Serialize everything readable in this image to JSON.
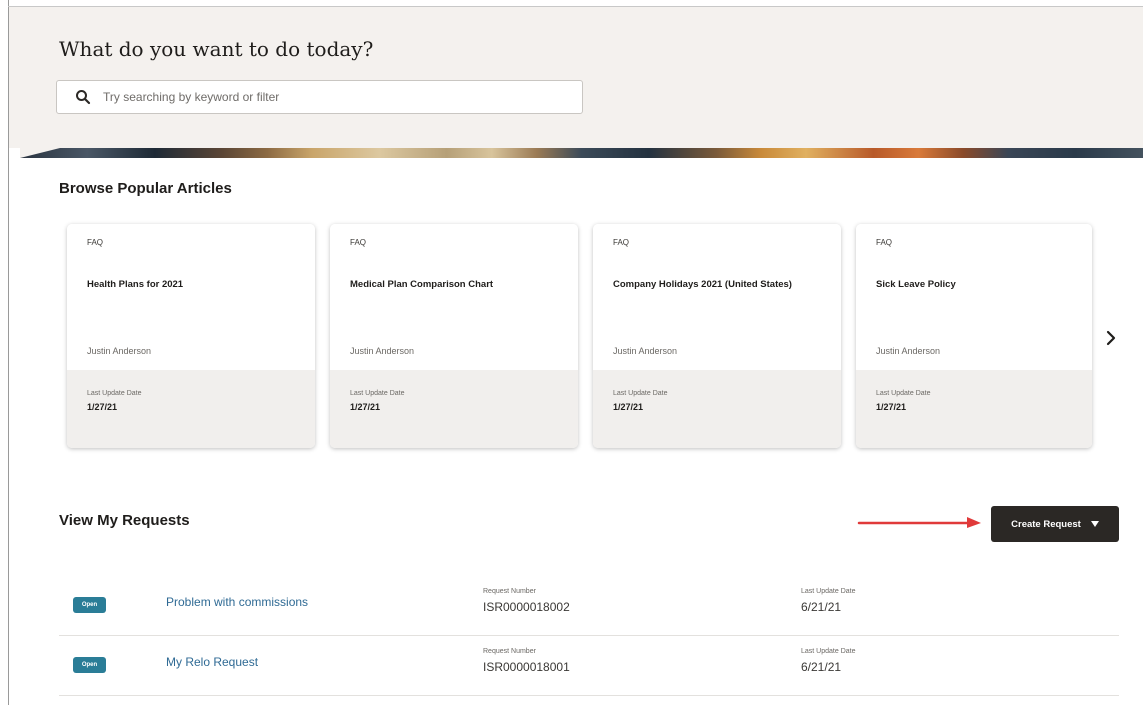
{
  "hero": {
    "title": "What do you want to do today?",
    "search_placeholder": "Try searching by keyword or filter"
  },
  "articles": {
    "section_title": "Browse Popular Articles",
    "items": [
      {
        "tag": "FAQ",
        "title": "Health Plans for 2021",
        "author": "Justin Anderson",
        "date_label": "Last Update Date",
        "date": "1/27/21"
      },
      {
        "tag": "FAQ",
        "title": "Medical Plan Comparison Chart",
        "author": "Justin Anderson",
        "date_label": "Last Update Date",
        "date": "1/27/21"
      },
      {
        "tag": "FAQ",
        "title": "Company Holidays 2021 (United States)",
        "author": "Justin Anderson",
        "date_label": "Last Update Date",
        "date": "1/27/21"
      },
      {
        "tag": "FAQ",
        "title": "Sick Leave Policy",
        "author": "Justin Anderson",
        "date_label": "Last Update Date",
        "date": "1/27/21"
      }
    ],
    "next_icon": "chevron-right-icon"
  },
  "requests": {
    "section_title": "View My Requests",
    "create_label": "Create Request",
    "items": [
      {
        "status": "Open",
        "title": "Problem with commissions",
        "number_label": "Request Number",
        "number": "ISR0000018002",
        "date_label": "Last Update Date",
        "date": "6/21/21"
      },
      {
        "status": "Open",
        "title": "My Relo Request",
        "number_label": "Request Number",
        "number": "ISR0000018001",
        "date_label": "Last Update Date",
        "date": "6/21/21"
      }
    ]
  },
  "colors": {
    "button_dark": "#2b2825",
    "status_badge": "#2a7d97",
    "link": "#2f6a94",
    "annotation_arrow": "#e03a3a",
    "hero_bg": "#f4f1ee"
  }
}
